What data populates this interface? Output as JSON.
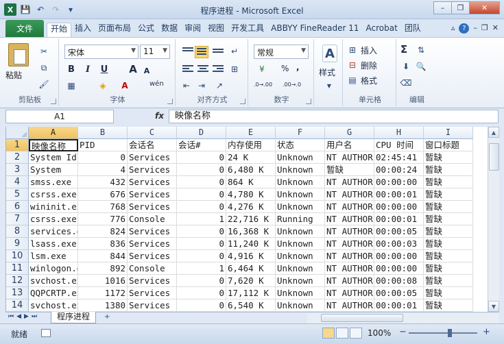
{
  "window": {
    "title": "程序进程 - Microsoft Excel",
    "minimize": "–",
    "restore": "❐",
    "close": "✕"
  },
  "qat": {
    "save": "💾",
    "undo": "↶",
    "redo": "↷",
    "customize": "▾"
  },
  "ribbon_tabs": {
    "file": "文件",
    "tabs": [
      "开始",
      "插入",
      "页面布局",
      "公式",
      "数据",
      "审阅",
      "视图",
      "开发工具",
      "ABBYY FineReader 11",
      "Acrobat",
      "团队"
    ],
    "active": "开始"
  },
  "ribbon": {
    "clipboard": {
      "label": "剪贴板",
      "paste": "粘贴"
    },
    "font": {
      "label": "字体",
      "font_name": "宋体",
      "font_size": "11",
      "bold": "B",
      "italic": "I",
      "underline": "U",
      "grow": "A",
      "shrink": "A",
      "wen": "wén"
    },
    "alignment": {
      "label": "对齐方式"
    },
    "number": {
      "label": "数字",
      "format": "常规",
      "percent": "%",
      "comma": ",",
      "inc_decimal": ".0→.00",
      "dec_decimal": ".00→.0"
    },
    "styles": {
      "label": "样式"
    },
    "cells": {
      "label": "单元格",
      "insert": "插入",
      "delete": "删除",
      "format": "格式"
    },
    "editing": {
      "label": "编辑",
      "sum": "Σ"
    }
  },
  "formula_bar": {
    "name_box": "A1",
    "fx": "fx",
    "content": "映像名称"
  },
  "grid": {
    "columns": [
      "A",
      "B",
      "C",
      "D",
      "E",
      "F",
      "G",
      "H",
      "I"
    ],
    "rows": [
      {
        "n": "1",
        "cells": [
          "映像名称",
          "PID",
          "会话名",
          "会话#",
          "内存使用",
          "状态",
          "用户名",
          "CPU 时间",
          "窗口标题"
        ]
      },
      {
        "n": "2",
        "cells": [
          "System Idle",
          "0",
          "Services",
          "0",
          "24 K",
          "Unknown",
          "NT AUTHORITY",
          "02:45:41",
          "暂缺"
        ]
      },
      {
        "n": "3",
        "cells": [
          "System",
          "4",
          "Services",
          "0",
          "6,480 K",
          "Unknown",
          "暂缺",
          "00:00:24",
          "暂缺"
        ]
      },
      {
        "n": "4",
        "cells": [
          "smss.exe",
          "432",
          "Services",
          "0",
          "864 K",
          "Unknown",
          "NT AUTHORITY",
          "00:00:00",
          "暂缺"
        ]
      },
      {
        "n": "5",
        "cells": [
          "csrss.exe",
          "676",
          "Services",
          "0",
          "4,780 K",
          "Unknown",
          "NT AUTHORITY",
          "00:00:01",
          "暂缺"
        ]
      },
      {
        "n": "6",
        "cells": [
          "wininit.exe",
          "768",
          "Services",
          "0",
          "4,276 K",
          "Unknown",
          "NT AUTHORITY",
          "00:00:00",
          "暂缺"
        ]
      },
      {
        "n": "7",
        "cells": [
          "csrss.exe",
          "776",
          "Console",
          "1",
          "22,716 K",
          "Running",
          "NT AUTHORITY",
          "00:00:01",
          "暂缺"
        ]
      },
      {
        "n": "8",
        "cells": [
          "services.exe",
          "824",
          "Services",
          "0",
          "16,368 K",
          "Unknown",
          "NT AUTHORITY",
          "00:00:05",
          "暂缺"
        ]
      },
      {
        "n": "9",
        "cells": [
          "lsass.exe",
          "836",
          "Services",
          "0",
          "11,240 K",
          "Unknown",
          "NT AUTHORITY",
          "00:00:03",
          "暂缺"
        ]
      },
      {
        "n": "10",
        "cells": [
          "lsm.exe",
          "844",
          "Services",
          "0",
          "4,916 K",
          "Unknown",
          "NT AUTHORITY",
          "00:00:00",
          "暂缺"
        ]
      },
      {
        "n": "11",
        "cells": [
          "winlogon.exe",
          "892",
          "Console",
          "1",
          "6,464 K",
          "Unknown",
          "NT AUTHORITY",
          "00:00:00",
          "暂缺"
        ]
      },
      {
        "n": "12",
        "cells": [
          "svchost.exe",
          "1016",
          "Services",
          "0",
          "7,620 K",
          "Unknown",
          "NT AUTHORITY",
          "00:00:08",
          "暂缺"
        ]
      },
      {
        "n": "13",
        "cells": [
          "QQPCRTP.exe",
          "1172",
          "Services",
          "0",
          "17,112 K",
          "Unknown",
          "NT AUTHORITY",
          "00:00:05",
          "暂缺"
        ]
      },
      {
        "n": "14",
        "cells": [
          "svchost.exe",
          "1380",
          "Services",
          "0",
          "6,540 K",
          "Unknown",
          "NT AUTHORITY",
          "00:00:01",
          "暂缺"
        ]
      }
    ]
  },
  "sheet_tabs": {
    "active": "程序进程",
    "new_sheet": "+"
  },
  "status": {
    "ready": "就绪",
    "zoom": "100%",
    "zoom_minus": "−",
    "zoom_plus": "+"
  }
}
